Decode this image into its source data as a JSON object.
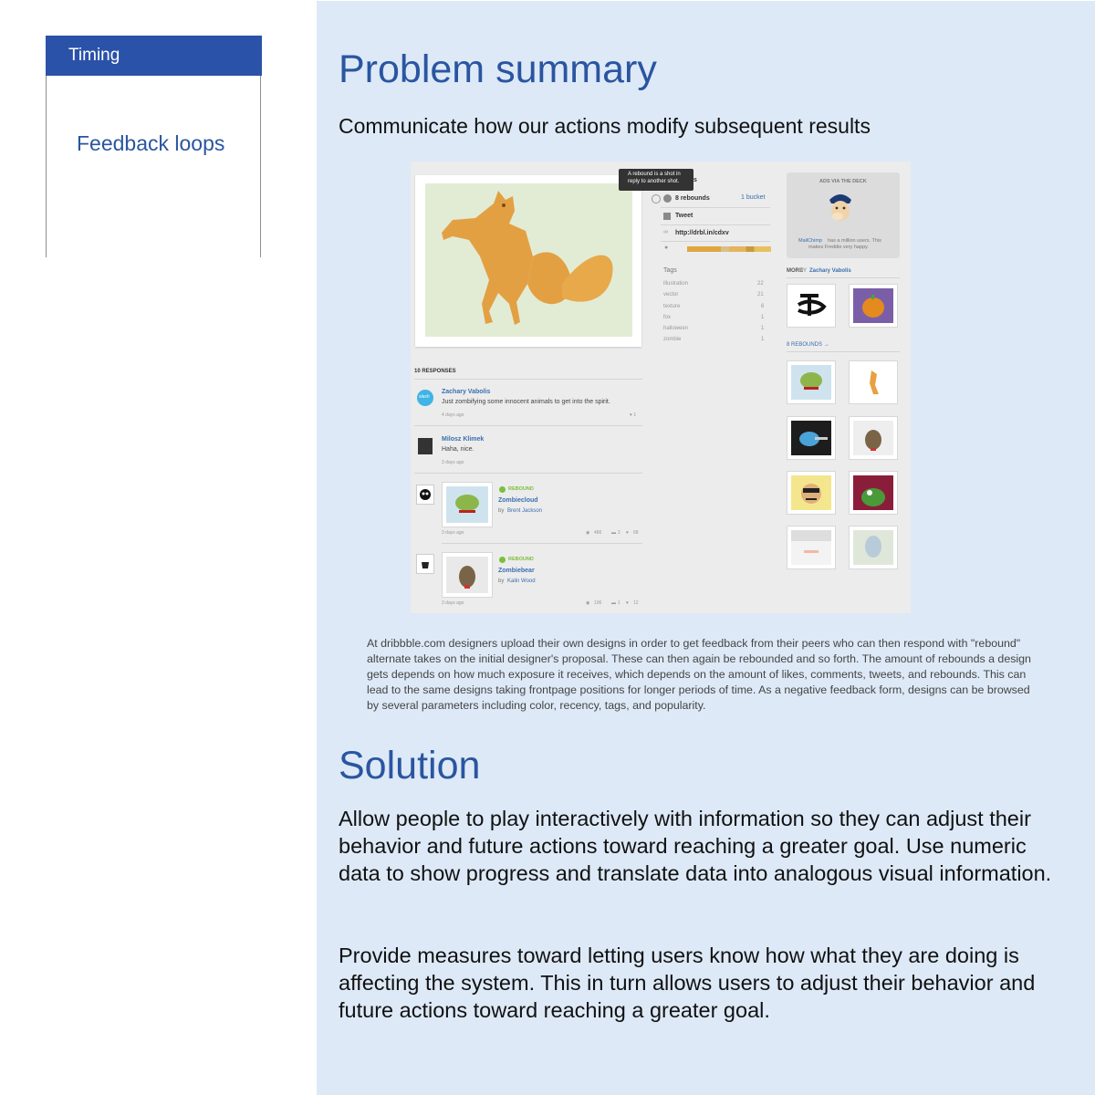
{
  "sidebar": {
    "header": "Timing",
    "items": [
      {
        "label": "Feedback loops"
      }
    ]
  },
  "problem": {
    "title": "Problem summary",
    "subtitle": "Communicate how our actions modify subsequent results",
    "caption": "At dribbble.com designers upload their own designs in order to get feedback from their peers who can then respond with \"rebound\" alternate takes on the initial designer's proposal. These can then again be rebounded and so forth. The amount of rebounds a design gets depends on how much exposure it receives, which depends on the amount of likes, comments, tweets, and rebounds. This can lead to the same designs taking frontpage positions for longer periods of time. As a negative feedback form, designs can be browsed by several parameters including color, recency, tags, and popularity."
  },
  "screenshot": {
    "tooltip_line1": "A rebound is a shot in",
    "tooltip_line2": "reply to another shot.",
    "stats": {
      "rebounds": "8 rebounds",
      "bucket": "1 bucket",
      "tweet": "Tweet",
      "url": "http://drbl.in/cdxv"
    },
    "tags_label": "Tags",
    "tags": [
      {
        "name": "illustration",
        "count": "22"
      },
      {
        "name": "vector",
        "count": "21"
      },
      {
        "name": "texture",
        "count": "6"
      },
      {
        "name": "fox",
        "count": "1"
      },
      {
        "name": "halloween",
        "count": "1"
      },
      {
        "name": "zombie",
        "count": "1"
      }
    ],
    "ad": {
      "label": "ADS VIA THE DECK",
      "brand": "MailChimp",
      "text1": "has a million users. This",
      "text2": "makes Freddie very happy."
    },
    "more_by_prefix": "MORE",
    "more_by_middle": "BY",
    "more_by_name": "Zachary Vabolis",
    "rebounds_link": "8 REBOUNDS →",
    "responses_header": "10 RESPONSES",
    "comments": [
      {
        "name": "Zachary Vabolis",
        "text": "Just zombifying some innocent animals to get into the spirit.",
        "time": "4 days ago",
        "likes": "♥ 1"
      },
      {
        "name": "Milosz Klimek",
        "text": "Haha, nice.",
        "time": "3 days ago"
      }
    ],
    "rebound_items": [
      {
        "badge": "REBOUND",
        "title": "Zombiecloud",
        "by": "by",
        "author": "Brent Jackson",
        "time": "3 days ago",
        "views": "486",
        "comments": "2",
        "likes": "68"
      },
      {
        "badge": "REBOUND",
        "title": "Zombiebear",
        "by": "by",
        "author": "Kalin Wood",
        "time": "3 days ago",
        "views": "106",
        "comments": "1",
        "likes": "12"
      }
    ],
    "avatar_text": "slash"
  },
  "solution": {
    "title": "Solution",
    "para1": "Allow people to play interactively with information so they can adjust their behavior and future actions toward reaching a greater goal. Use numeric data to show progress and translate data into analogous visual information.",
    "para2": "Provide measures toward letting users know how what they are doing is affecting the system. This in turn allows users to adjust their behavior and future actions toward reaching a greater goal."
  },
  "colors": {
    "accent": "#2a52a8",
    "panel": "#dde9f7",
    "link": "#2a55a0"
  }
}
